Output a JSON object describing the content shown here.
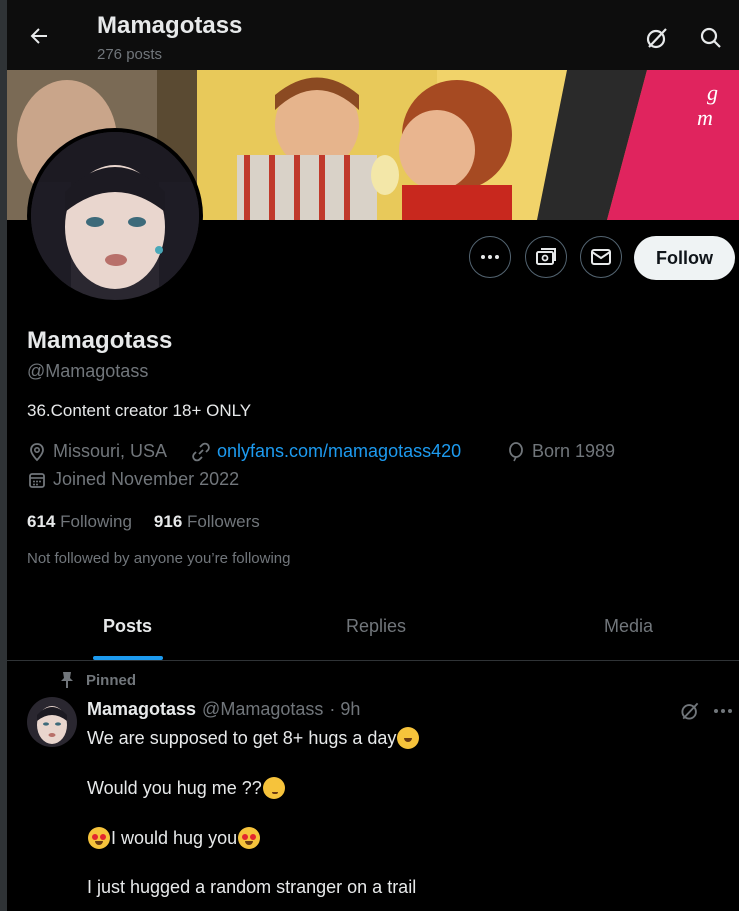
{
  "header": {
    "name": "Mamagotass",
    "post_count": "276 posts"
  },
  "profile": {
    "display_name": "Mamagotass",
    "handle": "@Mamagotass",
    "bio": "36.Content creator 18+ ONLY",
    "location": "Missouri, USA",
    "link": "onlyfans.com/mamagotass420",
    "birth": "Born 1989",
    "joined": "Joined November 2022",
    "following_count": "614",
    "following_label": "Following",
    "followers_count": "916",
    "followers_label": "Followers",
    "not_followed": "Not followed by anyone you’re following"
  },
  "actions": {
    "follow_label": "Follow"
  },
  "tabs": [
    {
      "label": "Posts",
      "active": true
    },
    {
      "label": "Replies",
      "active": false
    },
    {
      "label": "Media",
      "active": false
    }
  ],
  "post": {
    "pinned_label": "Pinned",
    "author_name": "Mamagotass",
    "author_handle": "@Mamagotass",
    "time": "· 9h",
    "line1": "We are supposed to get 8+ hugs a day",
    "line2": "Would you hug me ??",
    "line3": "I would hug you",
    "line4": "I just hugged a random stranger on a trail"
  },
  "icons": [
    "back-arrow-icon",
    "grok-icon",
    "search-icon",
    "more-icon",
    "subscribe-icon",
    "message-icon",
    "location-icon",
    "link-icon",
    "balloon-icon",
    "calendar-icon",
    "pin-icon"
  ],
  "colors": {
    "accent": "#1d9bf0",
    "muted": "#71767b",
    "follow_bg": "#eff3f4"
  }
}
